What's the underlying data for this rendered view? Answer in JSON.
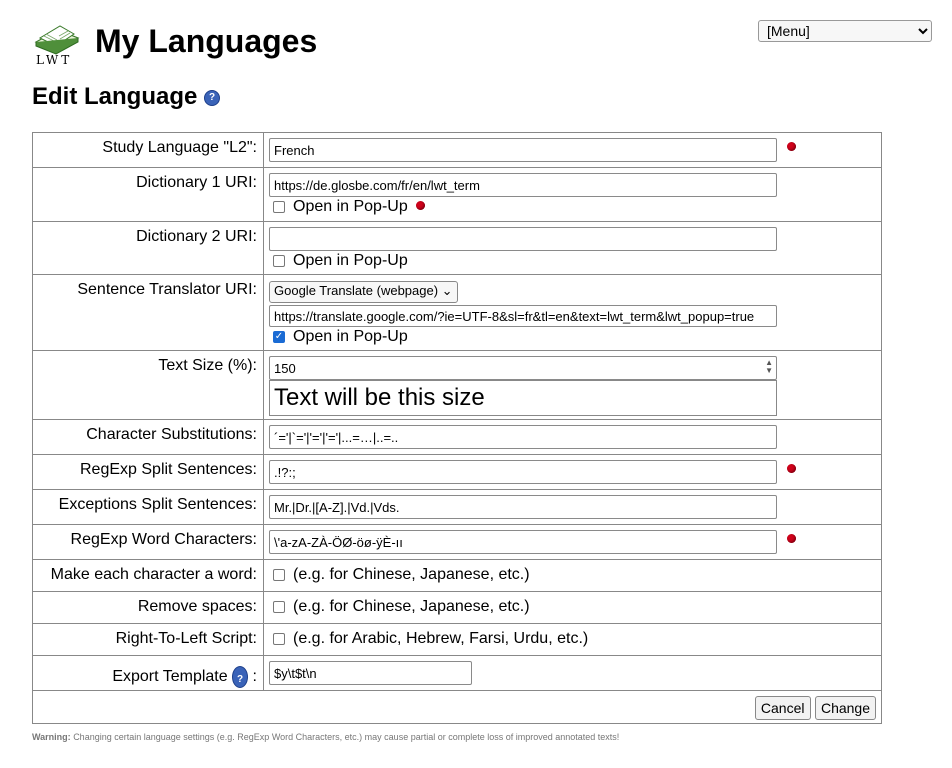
{
  "header": {
    "logo_text": "LWT",
    "title": "My Languages",
    "menu_value": "[Menu]"
  },
  "section": {
    "title": "Edit Language",
    "help_icon": "question-icon"
  },
  "form": {
    "study_language": {
      "label": "Study Language \"L2\":",
      "value": "French"
    },
    "dict1": {
      "label": "Dictionary 1 URI:",
      "value": "https://de.glosbe.com/fr/en/lwt_term",
      "popup_label": "Open in Pop-Up",
      "popup_checked": false
    },
    "dict2": {
      "label": "Dictionary 2 URI:",
      "value": "",
      "popup_label": "Open in Pop-Up",
      "popup_checked": false
    },
    "translator": {
      "label": "Sentence Translator URI:",
      "select_value": "Google Translate (webpage)",
      "value": "https://translate.google.com/?ie=UTF-8&sl=fr&tl=en&text=lwt_term&lwt_popup=true",
      "popup_label": "Open in Pop-Up",
      "popup_checked": true
    },
    "text_size": {
      "label": "Text Size (%):",
      "value": "150",
      "preview": "Text will be this size"
    },
    "char_subst": {
      "label": "Character Substitutions:",
      "value": "´='|`='|'='|'='|...=…|..=.."
    },
    "regexp_split": {
      "label": "RegExp Split Sentences:",
      "value": ".!?:;"
    },
    "exceptions_split": {
      "label": "Exceptions Split Sentences:",
      "value": "Mr.|Dr.|[A-Z].|Vd.|Vds."
    },
    "regexp_word": {
      "label": "RegExp Word Characters:",
      "value": "\\'a-zA-ZÀ-ÖØ-öø-ÿÈ-ıı"
    },
    "each_char_word": {
      "label": "Make each character a word:",
      "hint": "(e.g. for Chinese, Japanese, etc.)"
    },
    "remove_spaces": {
      "label": "Remove spaces:",
      "hint": "(e.g. for Chinese, Japanese, etc.)"
    },
    "rtl": {
      "label": "Right-To-Left Script:",
      "hint": "(e.g. for Arabic, Hebrew, Farsi, Urdu, etc.)"
    },
    "export_template": {
      "label": "Export Template",
      "label_suffix": ":",
      "value": "$y\\t$t\\n"
    }
  },
  "buttons": {
    "cancel": "Cancel",
    "change": "Change"
  },
  "warning": {
    "prefix": "Warning:",
    "text": "Changing certain language settings (e.g. RegExp Word Characters, etc.) may cause partial or complete loss of improved annotated texts!"
  },
  "colors": {
    "required_dot": "#d0021b",
    "help_icon": "#3a63b8",
    "checkbox_checked": "#1a6bd4"
  }
}
